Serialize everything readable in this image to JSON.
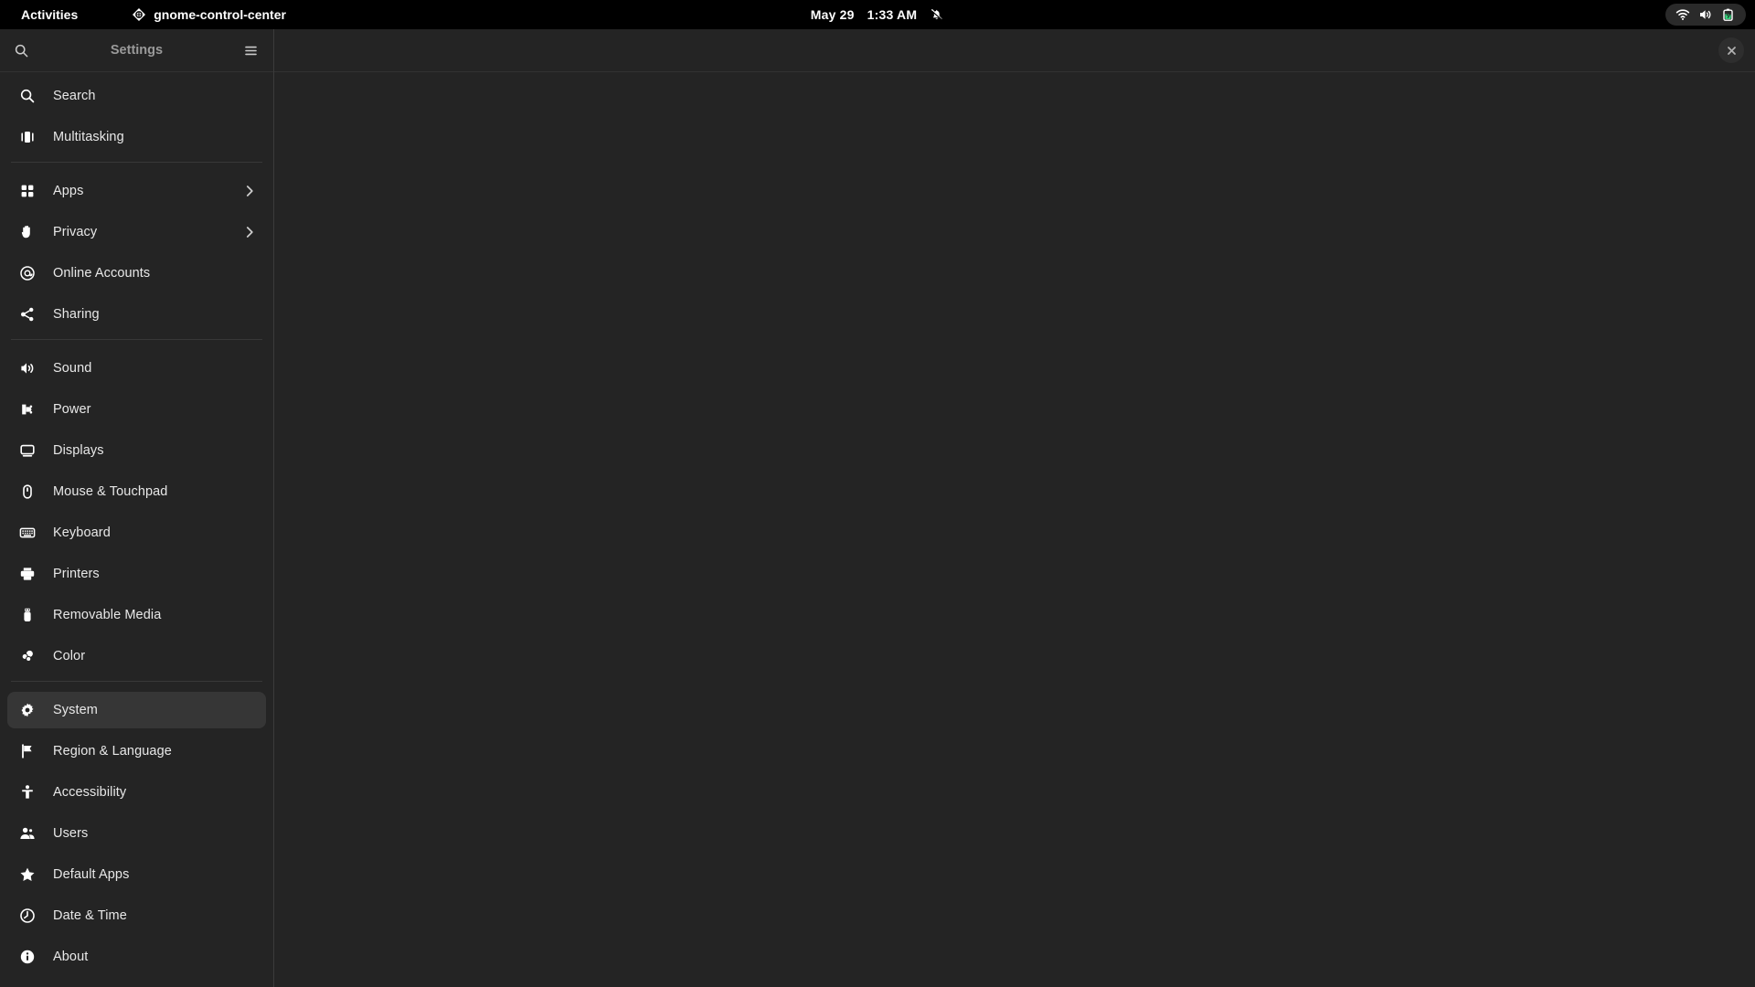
{
  "topbar": {
    "activities_label": "Activities",
    "app_name": "gnome-control-center",
    "app_icon": "gnome-control-center-icon",
    "date": "May 29",
    "time": "1:33 AM",
    "notification_icon": "bell-slash-icon",
    "status_icons": [
      "wifi-icon",
      "volume-icon",
      "battery-charging-icon"
    ],
    "battery_accent": "#33d17a"
  },
  "sidebar": {
    "title": "Settings",
    "search_icon": "search-icon",
    "menu_icon": "hamburger-menu-icon",
    "selected": "System",
    "groups": [
      {
        "items": [
          {
            "label": "Search",
            "icon": "search-icon",
            "chevron": false
          },
          {
            "label": "Multitasking",
            "icon": "multitasking-icon",
            "chevron": false
          }
        ]
      },
      {
        "items": [
          {
            "label": "Apps",
            "icon": "apps-grid-icon",
            "chevron": true
          },
          {
            "label": "Privacy",
            "icon": "hand-privacy-icon",
            "chevron": true
          },
          {
            "label": "Online Accounts",
            "icon": "at-sign-icon",
            "chevron": false
          },
          {
            "label": "Sharing",
            "icon": "share-nodes-icon",
            "chevron": false
          }
        ]
      },
      {
        "items": [
          {
            "label": "Sound",
            "icon": "speaker-icon",
            "chevron": false
          },
          {
            "label": "Power",
            "icon": "power-plug-icon",
            "chevron": false
          },
          {
            "label": "Displays",
            "icon": "monitor-icon",
            "chevron": false
          },
          {
            "label": "Mouse & Touchpad",
            "icon": "mouse-icon",
            "chevron": false
          },
          {
            "label": "Keyboard",
            "icon": "keyboard-icon",
            "chevron": false
          },
          {
            "label": "Printers",
            "icon": "printer-icon",
            "chevron": false
          },
          {
            "label": "Removable Media",
            "icon": "usb-drive-icon",
            "chevron": false
          },
          {
            "label": "Color",
            "icon": "color-circles-icon",
            "chevron": false
          }
        ]
      },
      {
        "items": [
          {
            "label": "System",
            "icon": "gear-icon",
            "chevron": false
          },
          {
            "label": "Region & Language",
            "icon": "flag-icon",
            "chevron": false
          },
          {
            "label": "Accessibility",
            "icon": "accessibility-person-icon",
            "chevron": false
          },
          {
            "label": "Users",
            "icon": "users-icon",
            "chevron": false
          },
          {
            "label": "Default Apps",
            "icon": "star-icon",
            "chevron": false
          },
          {
            "label": "Date & Time",
            "icon": "clock-icon",
            "chevron": false
          },
          {
            "label": "About",
            "icon": "info-circle-icon",
            "chevron": false
          }
        ]
      }
    ]
  },
  "content": {
    "close_icon": "close-icon",
    "body_text": ""
  }
}
